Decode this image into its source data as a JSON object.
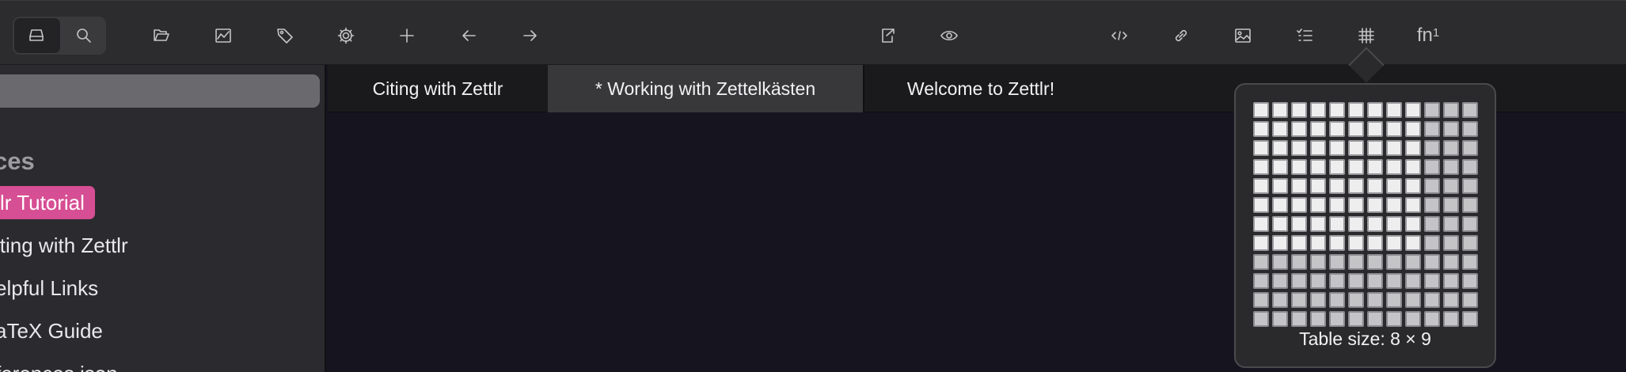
{
  "toolbar": {
    "groups": [
      {
        "name": "file-manager-icon",
        "active": true
      },
      {
        "name": "global-search-icon",
        "active": false
      }
    ],
    "buttons": [
      "open-workspace-icon",
      "graph-view-icon",
      "tags-icon",
      "settings-icon",
      "new-file-icon",
      "back-icon",
      "forward-icon",
      "export-icon",
      "preview-icon",
      "code-icon",
      "link-icon",
      "image-icon",
      "tasks-icon",
      "table-icon",
      "footnote-icon"
    ],
    "footnote_label": "fn",
    "footnote_sup": "1"
  },
  "sidebar": {
    "heading": "ces",
    "tag_label": "lr Tutorial",
    "tag_color": "#d64e93",
    "items": [
      "iting with Zettlr",
      "elpful Links",
      "aTeX Guide",
      "ferences.json"
    ]
  },
  "tabs": [
    {
      "label": "Citing with Zettlr",
      "active": false
    },
    {
      "label": "* Working with Zettelkästen",
      "active": true
    },
    {
      "label": "Welcome to Zettlr!",
      "active": false
    }
  ],
  "table_popover": {
    "grid_cols": 12,
    "grid_rows": 12,
    "selected_cols": 9,
    "selected_rows": 8,
    "size_label": "Table size: 8 × 9"
  }
}
